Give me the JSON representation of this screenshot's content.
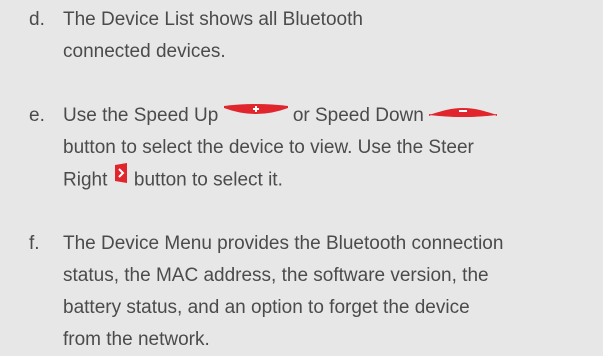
{
  "steps": [
    {
      "letter": "d.",
      "lines": [
        "The Device List shows all Bluetooth",
        "connected devices."
      ]
    },
    {
      "letter": "e.",
      "line1_before_up": "Use the Speed Up",
      "line1_between": "or Speed Down",
      "line2": "button to select the device to view. Use the Steer",
      "line3_before_icon": "Right",
      "line3_after_icon": "button to select it."
    },
    {
      "letter": "f.",
      "lines": [
        "The Device Menu provides the Bluetooth connection",
        "status, the MAC address, the software version, the",
        "battery status, and an option to forget the device",
        "from the network."
      ]
    }
  ],
  "icons": {
    "speed_up": "speed-up-plus-icon",
    "speed_down": "speed-down-minus-icon",
    "steer_right": "steer-right-chevron-icon"
  },
  "colors": {
    "background": "#e7e7e7",
    "text": "#4b4b4b",
    "button_red": "#e0262c"
  }
}
